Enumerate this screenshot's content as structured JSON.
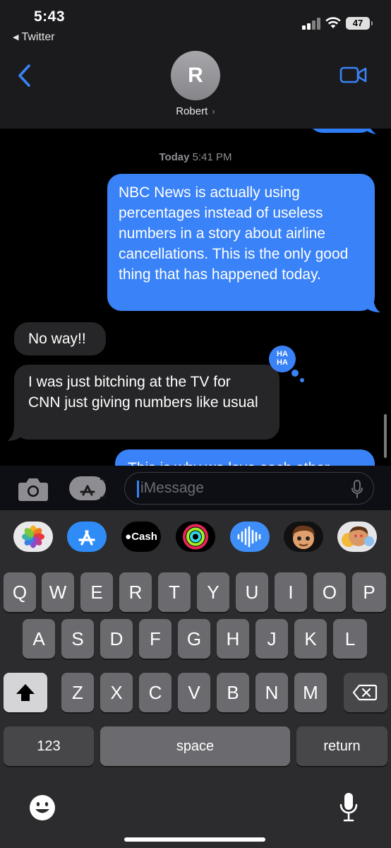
{
  "status_bar": {
    "time": "5:43",
    "back_app": "Twitter",
    "battery": "47"
  },
  "header": {
    "avatar_initial": "R",
    "contact_name": "Robert",
    "chevron": "›"
  },
  "thread": {
    "timestamp_day": "Today",
    "timestamp_time": "5:41 PM",
    "messages": [
      {
        "direction": "outgoing",
        "text": "NBC News is actually using percentages instead of useless numbers in a story about airline cancellations. This is the only good thing that has happened today."
      },
      {
        "direction": "incoming",
        "text": "No way!!"
      },
      {
        "direction": "incoming",
        "text": "I was just bitching at the TV for CNN just giving numbers like usual",
        "reaction": "HA HA"
      },
      {
        "direction": "outgoing",
        "text": "This is why we love each other"
      }
    ]
  },
  "input": {
    "placeholder": "iMessage"
  },
  "apps": [
    {
      "name": "photos-icon"
    },
    {
      "name": "app-store-icon"
    },
    {
      "name": "cash-icon",
      "label": "Cash"
    },
    {
      "name": "fitness-icon"
    },
    {
      "name": "audio-message-icon"
    },
    {
      "name": "memoji-icon"
    },
    {
      "name": "memoji-stickers-icon"
    }
  ],
  "keyboard": {
    "row1": [
      "Q",
      "W",
      "E",
      "R",
      "T",
      "Y",
      "U",
      "I",
      "O",
      "P"
    ],
    "row2": [
      "A",
      "S",
      "D",
      "F",
      "G",
      "H",
      "J",
      "K",
      "L"
    ],
    "row3": [
      "Z",
      "X",
      "C",
      "V",
      "B",
      "N",
      "M"
    ],
    "numbers": "123",
    "space": "space",
    "return": "return"
  },
  "colors": {
    "outgoing_bubble": "#3a82f7",
    "incoming_bubble": "#262628",
    "accent": "#3a82f7"
  }
}
